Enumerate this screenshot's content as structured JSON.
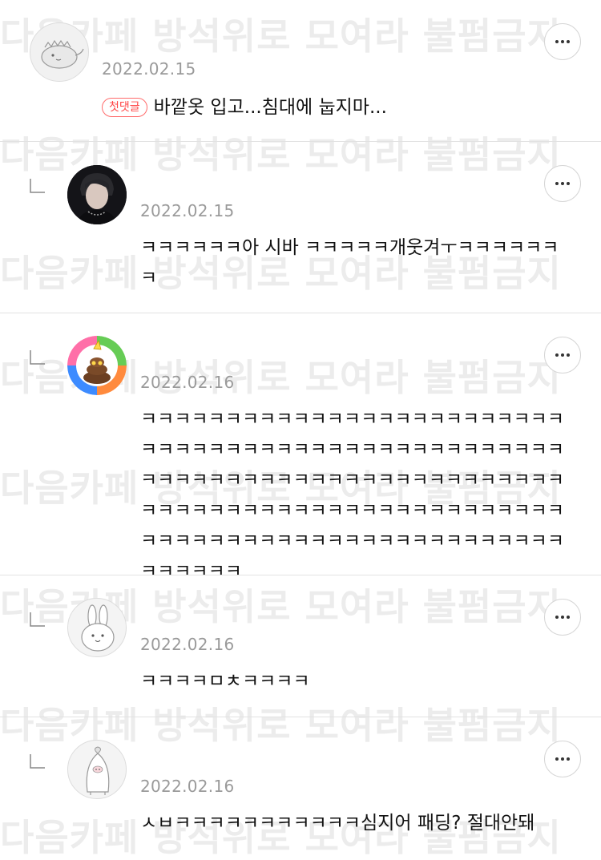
{
  "watermark": "다음카페 방석위로 모여라 불펌금지",
  "comments": [
    {
      "avatar": "dinosaur-sticker",
      "date": "2022.02.15",
      "badge": "첫댓글",
      "text": "바깥옷 입고...침대에 눕지마...",
      "more_icon": "more-horizontal-icon"
    },
    {
      "avatar": "person-photo",
      "date": "2022.02.15",
      "text": "ㅋㅋㅋㅋㅋㅋ아 시바 ㅋㅋㅋㅋㅋ개웃겨ㅜㅋㅋㅋㅋㅋㅋㅋ",
      "more_icon": "more-horizontal-icon"
    },
    {
      "avatar": "poop-party-character",
      "date": "2022.02.16",
      "text": "ㅋㅋㅋㅋㅋㅋㅋㅋㅋㅋㅋㅋㅋㅋㅋㅋㅋㅋㅋㅋㅋㅋㅋㅋㅋㅋㅋㅋㅋㅋㅋㅋㅋㅋㅋㅋㅋㅋㅋㅋㅋㅋㅋㅋㅋㅋㅋㅋㅋㅋㅋㅋㅋㅋㅋㅋㅋㅋㅋㅋㅋㅋㅋㅋㅋㅋㅋㅋㅋㅋㅋㅋㅋㅋㅋㅋㅋㅋㅋㅋㅋㅋㅋㅋㅋㅋㅋㅋㅋㅋㅋㅋㅋㅋㅋㅋㅋㅋㅋㅋㅋㅋㅋㅋㅋㅋㅋㅋㅋㅋㅋㅋㅋㅋㅋㅋㅋㅋㅋㅋㅋㅋㅋㅋㅋㅋㅋㅋㅋㅋㅋ",
      "more_icon": "more-horizontal-icon"
    },
    {
      "avatar": "rabbit-sticker",
      "date": "2022.02.16",
      "text": "ㅋㅋㅋㅋㅁㅊㅋㅋㅋㅋ",
      "more_icon": "more-horizontal-icon"
    },
    {
      "avatar": "penguin-sticker",
      "date": "2022.02.16",
      "text": "ㅅㅂㅋㅋㅋㅋㅋㅋㅋㅋㅋㅋㅋ심지어 패딩? 절대안돼",
      "more_icon": "more-horizontal-icon"
    }
  ]
}
